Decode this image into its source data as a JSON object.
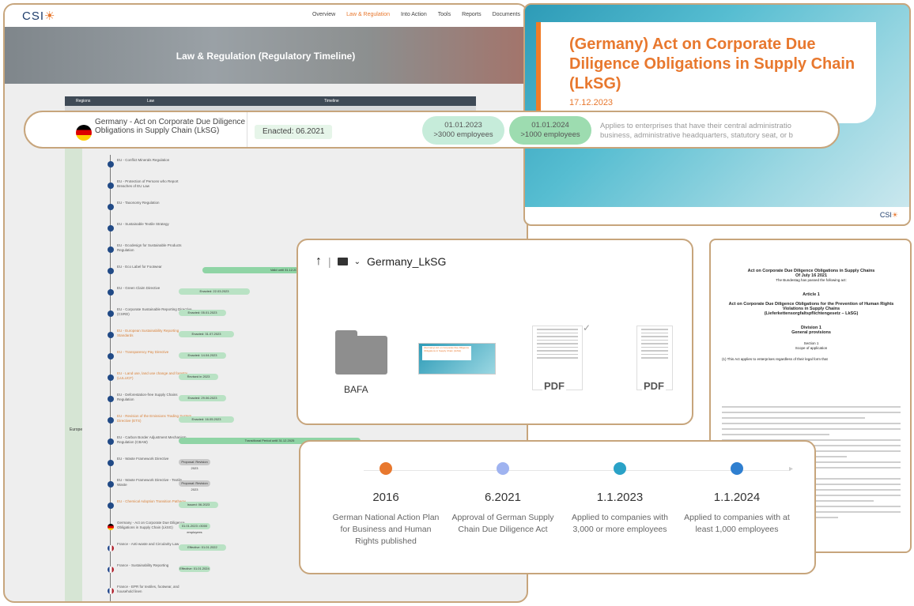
{
  "timeline": {
    "logo": "CSI",
    "nav": [
      "Overview",
      "Law & Regulation",
      "Into Action",
      "Tools",
      "Reports",
      "Documents"
    ],
    "hero_title": "Law & Regulation (Regulatory Timeline)",
    "table_headers": {
      "regions": "Regions",
      "law": "Law",
      "timeline": "Timeline"
    },
    "region_label": "Europe",
    "rows": [
      {
        "name": "EU - Conflict Minerals Regulation",
        "flag": "eu"
      },
      {
        "name": "EU - Protection of Persons who Report Breaches of EU Law",
        "flag": "eu"
      },
      {
        "name": "EU - Taxonomy Regulation",
        "flag": "eu"
      },
      {
        "name": "EU - Sustainable Textile Strategy",
        "flag": "eu"
      },
      {
        "name": "EU - Ecodesign for Sustainable Products Regulation",
        "flag": "eu"
      },
      {
        "name": "EU - Eco Label for Footwear",
        "flag": "eu",
        "bar": "Valid until 31.12.2025"
      },
      {
        "name": "EU - Green Claim Directive",
        "flag": "eu",
        "bar": "Enacted: 22.03.2023"
      },
      {
        "name": "EU - Corporate Sustainable Reporting Directive (CSRD)",
        "flag": "eu",
        "bar": "Enacted: 05.01.2023"
      },
      {
        "name": "EU - European Sustainability Reporting Standards",
        "flag": "eu",
        "orange": true,
        "bar": "Enacted: 31.07.2023"
      },
      {
        "name": "EU - Transparency Pay Directive",
        "flag": "eu",
        "orange": true,
        "bar": "Enacted: 14.04.2023"
      },
      {
        "name": "EU - Land use, land use change and forestry (LULUCF)",
        "flag": "eu",
        "orange": true,
        "bar": "Revised in 2023"
      },
      {
        "name": "EU - Deforestation-free Supply Chains Regulation",
        "flag": "eu",
        "bar": "Enacted: 29.06.2023"
      },
      {
        "name": "EU - Revision of the Emissions Trading System Directive (ETS)",
        "flag": "eu",
        "orange": true,
        "bar": "Enacted: 16.05.2023"
      },
      {
        "name": "EU - Carbon Border Adjustment Mechanism Regulation (CBAM)",
        "flag": "eu",
        "bar": "Transitional Period until 31.12.2025"
      },
      {
        "name": "EU - Waste Framework Directive",
        "flag": "eu",
        "bar": "Proposal: Revision 2023",
        "grey": true
      },
      {
        "name": "EU - Waste Framework Directive - Textile Waste",
        "flag": "eu",
        "bar": "Proposal: Revision 2023",
        "grey": true
      },
      {
        "name": "EU - Chemical Adoption Transition Pathway",
        "flag": "eu",
        "orange": true,
        "bar": "Issued: 06.2023"
      },
      {
        "name": "Germany - Act on Corporate Due Diligence Obligations in Supply Chain (LkSG)",
        "flag": "de",
        "bar": "01.01.2023 >3000 employees"
      },
      {
        "name": "France - Anti-waste and Circularity Law",
        "flag": "fr",
        "bar": "Effective: 01.01.2022"
      },
      {
        "name": "France - Sustainability Reporting",
        "flag": "fr",
        "bar": "Effective: 01.01.2024"
      },
      {
        "name": "France - EPR for textiles, footwear, and household linen",
        "flag": "fr"
      }
    ]
  },
  "highlight": {
    "law": "Germany - Act on Corporate Due Diligence Obligations in Supply Chain (LkSG)",
    "enacted": "Enacted: 06.2021",
    "milestone1": {
      "date": "01.01.2023",
      "threshold": ">3000 employees"
    },
    "milestone2": {
      "date": "01.01.2024",
      "threshold": ">1000 employees"
    },
    "applies": "Applies to enterprises that have their central administratio business, administrative headquarters, statutory seat, or b"
  },
  "slide": {
    "title": "(Germany) Act on Corporate Due Diligence Obligations in Supply Chain (LkSG)",
    "date": "17.12.2023",
    "footer_logo": "CSI"
  },
  "files": {
    "folder_name": "Germany_LkSG",
    "folder_item_label": "BAFA",
    "pdf_label": "PDF",
    "slide_thumb_title": "(Germany) Act on Corporate Due Diligence Obligations in Supply Chain (LkSG)"
  },
  "document": {
    "heading": "Act on Corporate Due Diligence Obligations in Supply Chains",
    "date_line": "Of July 16 2021",
    "intro": "The Bundestag has passed the following act:",
    "article": "Article 1",
    "article_title": "Act on Corporate Due Diligence Obligations for the Prevention of Human Rights Violations in Supply Chains",
    "article_subtitle": "(Lieferkettensorgfaltspflichtengesetz – LkSG)",
    "division": "Division 1",
    "division_title": "General provisions",
    "section": "Section 1",
    "section_title": "Scope of application",
    "para1": "(1) This Act applies to enterprises regardless of their legal form that"
  },
  "milestones": [
    {
      "year": "2016",
      "desc": "German National Action Plan for Business and Human Rights published",
      "color": "#e8782e"
    },
    {
      "year": "6.2021",
      "desc": "Approval of German Supply Chain Due Diligence Act",
      "color": "#9fb3f0"
    },
    {
      "year": "1.1.2023",
      "desc": "Applied to companies with 3,000 or more employees",
      "color": "#2aa2c7"
    },
    {
      "year": "1.1.2024",
      "desc": "Applied to companies with at least 1,000 employees",
      "color": "#2f7fd0"
    }
  ]
}
